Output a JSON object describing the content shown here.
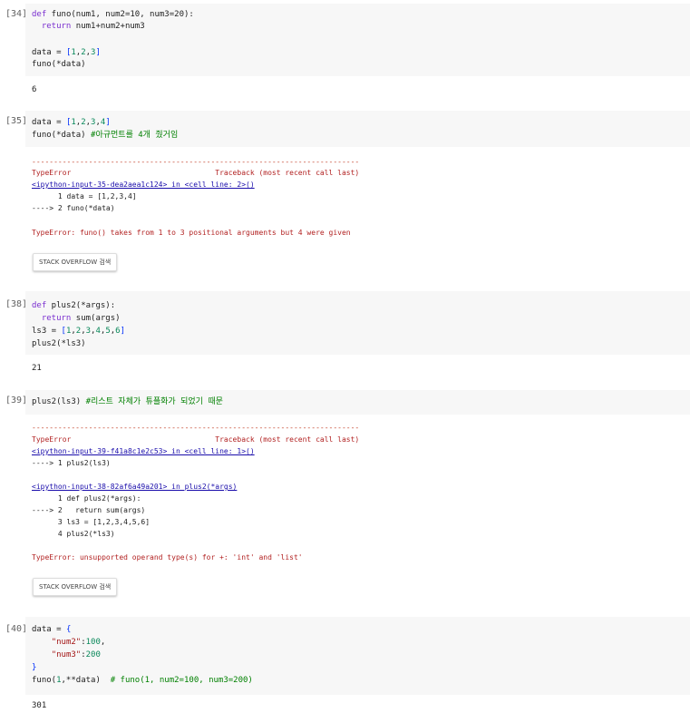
{
  "cells": [
    {
      "count": "[34]",
      "code": [
        "def funo(num1, num2=10, num3=20):",
        "  return num1+num2+num3",
        "",
        "data = [1,2,3]",
        "funo(*data)"
      ],
      "output": [
        "6"
      ]
    },
    {
      "count": "[35]",
      "code": [
        "data = [1,2,3,4]",
        "funo(*data) #아규먼트를 4개 줬거임"
      ],
      "output": [
        "---------------------------------------------------------------------------",
        "TypeError                                 Traceback (most recent call last)",
        "<ipython-input-35-dea2aea1c124> in <cell line: 2>()",
        "      1 data = [1,2,3,4]",
        "----> 2 funo(*data)",
        "",
        "TypeError: funo() takes from 1 to 3 positional arguments but 4 were given"
      ],
      "button": "STACK OVERFLOW 검색"
    },
    {
      "count": "[38]",
      "code": [
        "def plus2(*args):",
        "  return sum(args)",
        "ls3 = [1,2,3,4,5,6]",
        "plus2(*ls3)"
      ],
      "output": [
        "21"
      ]
    },
    {
      "count": "[39]",
      "code": [
        "plus2(ls3) #리스트 자체가 튜플화가 되었기 때문"
      ],
      "output": [
        "---------------------------------------------------------------------------",
        "TypeError                                 Traceback (most recent call last)",
        "<ipython-input-39-f41a8c1e2c53> in <cell line: 1>()",
        "----> 1 plus2(ls3)",
        "",
        "<ipython-input-38-82af6a49a201> in plus2(*args)",
        "      1 def plus2(*args):",
        "----> 2   return sum(args)",
        "      3 ls3 = [1,2,3,4,5,6]",
        "      4 plus2(*ls3)",
        "",
        "TypeError: unsupported operand type(s) for +: 'int' and 'list'"
      ],
      "button": "STACK OVERFLOW 검색"
    },
    {
      "count": "[40]",
      "code": [
        "data = {",
        "    \"num2\":100,",
        "    \"num3\":200",
        "}",
        "funo(1,**data)  # funo(1, num2=100, num3=200)"
      ],
      "output": [
        "301"
      ]
    }
  ]
}
